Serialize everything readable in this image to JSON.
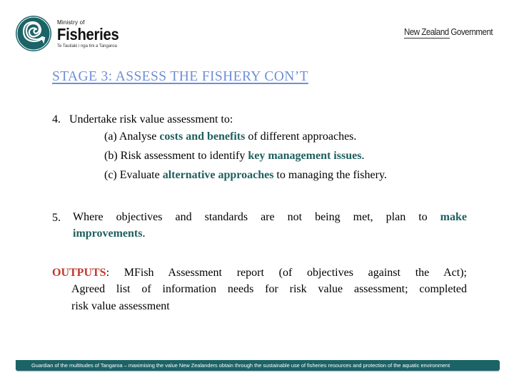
{
  "header": {
    "logo": {
      "icon": "fisheries-spiral-icon",
      "ministry_label": "Ministry of",
      "name": "Fisheries",
      "tagline": "Te Tautiaki i nga tini a Tangaroa"
    },
    "government_label": "New Zealand Government"
  },
  "slide": {
    "title": "STAGE 3: ASSESS THE FISHERY CON’T",
    "item4": {
      "number": "4.",
      "text": "Undertake risk value assessment to:",
      "subitems": [
        {
          "pre": "(a) Analyse ",
          "em": "costs and benefits",
          "post": " of different approaches."
        },
        {
          "pre": "(b) Risk assessment to identify ",
          "em": "key management issues",
          "post": "."
        },
        {
          "pre": "(c) Evaluate ",
          "em": "alternative approaches",
          "post": " to managing the fishery."
        }
      ]
    },
    "item5": {
      "number": "5.",
      "line1": "Where objectives and standards are not being met, plan to",
      "em1": "make",
      "em2": "improvements",
      "end": "."
    },
    "outputs": {
      "label": "OUTPUTS",
      "line1": ": MFish Assessment report (of objectives against the Act);",
      "line2": "Agreed list of information needs for risk value assessment; completed",
      "line3": "risk value assessment"
    }
  },
  "footer": {
    "text": "Guardian of the multitudes of Tangaroa – maximising the value New Zealanders obtain through the sustainable use of fisheries resources and protection of the aquatic environment",
    "color": "#1b6366"
  },
  "colors": {
    "title": "#6f8fd6",
    "emphasis": "#1f5f5f",
    "outputs_label": "#c0392b"
  }
}
